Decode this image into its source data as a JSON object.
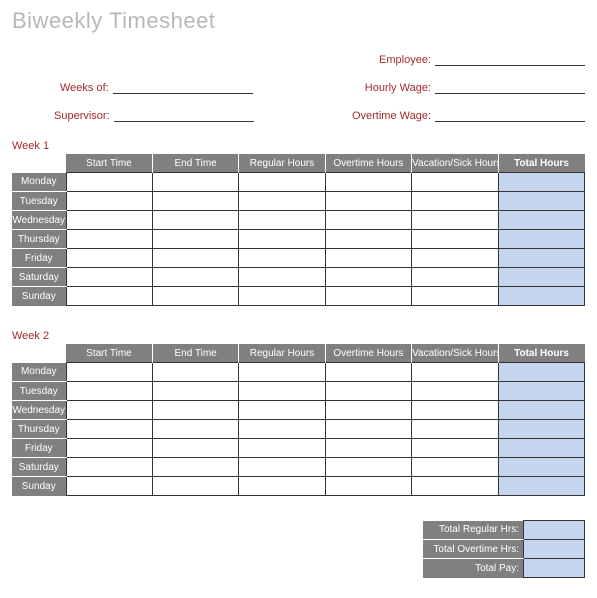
{
  "title": "Biweekly Timesheet",
  "fields": {
    "employee": "Employee:",
    "weeks_of": "Weeks of:",
    "hourly_wage": "Hourly Wage:",
    "supervisor": "Supervisor:",
    "overtime_wage": "Overtime Wage:"
  },
  "values": {
    "employee": "",
    "weeks_of": "",
    "hourly_wage": "",
    "supervisor": "",
    "overtime_wage": ""
  },
  "columns": {
    "start": "Start Time",
    "end": "End Time",
    "regular": "Regular Hours",
    "overtime": "Overtime Hours",
    "vacation": "Vacation/Sick Hours",
    "total": "Total Hours"
  },
  "days": {
    "mon": "Monday",
    "tue": "Tuesday",
    "wed": "Wednesday",
    "thu": "Thursday",
    "fri": "Friday",
    "sat": "Saturday",
    "sun": "Sunday"
  },
  "week1": {
    "label": "Week 1",
    "rows": {
      "mon": {
        "start": "",
        "end": "",
        "regular": "",
        "overtime": "",
        "vacation": "",
        "total": ""
      },
      "tue": {
        "start": "",
        "end": "",
        "regular": "",
        "overtime": "",
        "vacation": "",
        "total": ""
      },
      "wed": {
        "start": "",
        "end": "",
        "regular": "",
        "overtime": "",
        "vacation": "",
        "total": ""
      },
      "thu": {
        "start": "",
        "end": "",
        "regular": "",
        "overtime": "",
        "vacation": "",
        "total": ""
      },
      "fri": {
        "start": "",
        "end": "",
        "regular": "",
        "overtime": "",
        "vacation": "",
        "total": ""
      },
      "sat": {
        "start": "",
        "end": "",
        "regular": "",
        "overtime": "",
        "vacation": "",
        "total": ""
      },
      "sun": {
        "start": "",
        "end": "",
        "regular": "",
        "overtime": "",
        "vacation": "",
        "total": ""
      }
    }
  },
  "week2": {
    "label": "Week 2",
    "rows": {
      "mon": {
        "start": "",
        "end": "",
        "regular": "",
        "overtime": "",
        "vacation": "",
        "total": ""
      },
      "tue": {
        "start": "",
        "end": "",
        "regular": "",
        "overtime": "",
        "vacation": "",
        "total": ""
      },
      "wed": {
        "start": "",
        "end": "",
        "regular": "",
        "overtime": "",
        "vacation": "",
        "total": ""
      },
      "thu": {
        "start": "",
        "end": "",
        "regular": "",
        "overtime": "",
        "vacation": "",
        "total": ""
      },
      "fri": {
        "start": "",
        "end": "",
        "regular": "",
        "overtime": "",
        "vacation": "",
        "total": ""
      },
      "sat": {
        "start": "",
        "end": "",
        "regular": "",
        "overtime": "",
        "vacation": "",
        "total": ""
      },
      "sun": {
        "start": "",
        "end": "",
        "regular": "",
        "overtime": "",
        "vacation": "",
        "total": ""
      }
    }
  },
  "summary": {
    "regular_label": "Total Regular Hrs:",
    "overtime_label": "Total Overtime Hrs:",
    "pay_label": "Total Pay:",
    "regular_value": "",
    "overtime_value": "",
    "pay_value": ""
  }
}
